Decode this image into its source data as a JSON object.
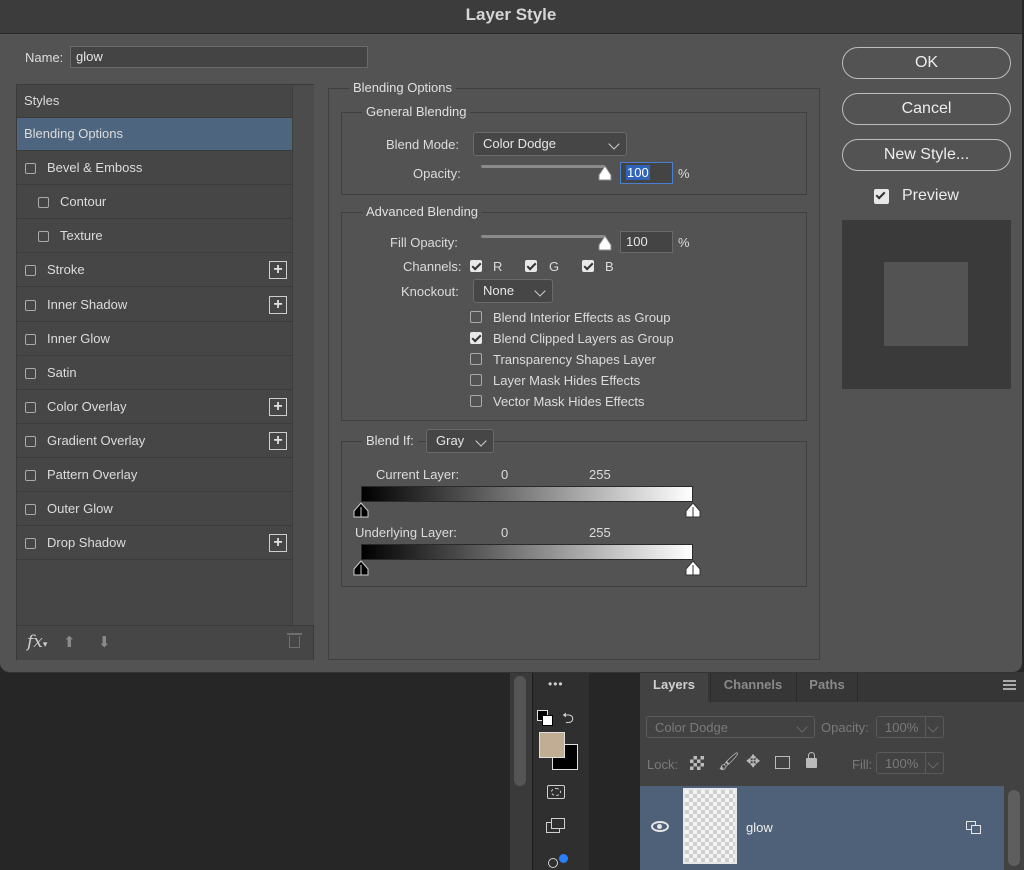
{
  "dialog": {
    "title": "Layer Style",
    "name_label": "Name:",
    "name_value": "glow"
  },
  "styles": {
    "header": "Styles",
    "items": [
      {
        "label": "Blending Options",
        "checkbox": false,
        "plus": false,
        "selected": true
      },
      {
        "label": "Bevel & Emboss",
        "checkbox": true,
        "plus": false
      },
      {
        "label": "Contour",
        "checkbox": true,
        "plus": false,
        "indent": true
      },
      {
        "label": "Texture",
        "checkbox": true,
        "plus": false,
        "indent": true
      },
      {
        "label": "Stroke",
        "checkbox": true,
        "plus": true
      },
      {
        "label": "Inner Shadow",
        "checkbox": true,
        "plus": true
      },
      {
        "label": "Inner Glow",
        "checkbox": true,
        "plus": false
      },
      {
        "label": "Satin",
        "checkbox": true,
        "plus": false
      },
      {
        "label": "Color Overlay",
        "checkbox": true,
        "plus": true
      },
      {
        "label": "Gradient Overlay",
        "checkbox": true,
        "plus": true
      },
      {
        "label": "Pattern Overlay",
        "checkbox": true,
        "plus": false
      },
      {
        "label": "Outer Glow",
        "checkbox": true,
        "plus": false
      },
      {
        "label": "Drop Shadow",
        "checkbox": true,
        "plus": true
      }
    ],
    "footer_fx": "fx"
  },
  "blending": {
    "section_title": "Blending Options",
    "general": {
      "title": "General Blending",
      "blend_mode_label": "Blend Mode:",
      "blend_mode_value": "Color Dodge",
      "opacity_label": "Opacity:",
      "opacity_value": "100",
      "opacity_unit": "%",
      "opacity_level": 1.0
    },
    "advanced": {
      "title": "Advanced Blending",
      "fill_opacity_label": "Fill Opacity:",
      "fill_opacity_value": "100",
      "fill_opacity_unit": "%",
      "fill_opacity_level": 1.0,
      "channels_label": "Channels:",
      "channels": [
        {
          "label": "R",
          "checked": true
        },
        {
          "label": "G",
          "checked": true
        },
        {
          "label": "B",
          "checked": true
        }
      ],
      "knockout_label": "Knockout:",
      "knockout_value": "None",
      "options": [
        {
          "label": "Blend Interior Effects as Group",
          "checked": false
        },
        {
          "label": "Blend Clipped Layers as Group",
          "checked": true
        },
        {
          "label": "Transparency Shapes Layer",
          "checked": false
        },
        {
          "label": "Layer Mask Hides Effects",
          "checked": false
        },
        {
          "label": "Vector Mask Hides Effects",
          "checked": false
        }
      ]
    },
    "blend_if": {
      "label": "Blend If:",
      "value": "Gray",
      "current_layer_label": "Current Layer:",
      "current_min": "0",
      "current_max": "255",
      "underlying_layer_label": "Underlying Layer:",
      "underlying_min": "0",
      "underlying_max": "255"
    }
  },
  "buttons": {
    "ok": "OK",
    "cancel": "Cancel",
    "new_style": "New Style...",
    "preview_label": "Preview",
    "preview_checked": true
  },
  "layers_panel": {
    "tabs": [
      "Layers",
      "Channels",
      "Paths"
    ],
    "active_tab": "Layers",
    "blend_mode": "Color Dodge",
    "opacity_label": "Opacity:",
    "opacity_value": "100%",
    "lock_label": "Lock:",
    "fill_label": "Fill:",
    "fill_value": "100%",
    "layer_name": "glow"
  },
  "toolbar": {
    "more": "•••"
  }
}
